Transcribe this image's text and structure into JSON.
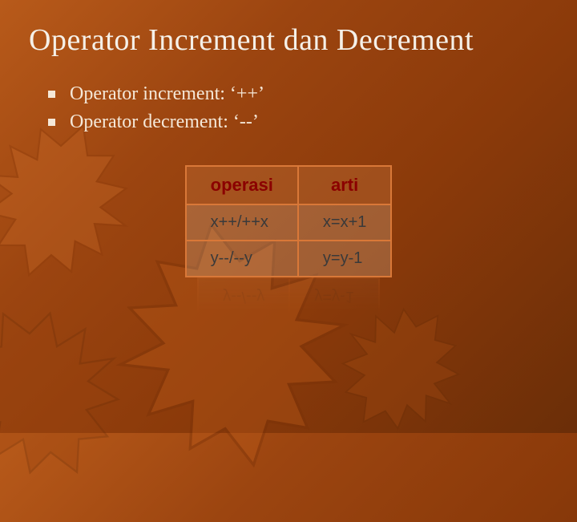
{
  "title": "Operator Increment dan Decrement",
  "bullets": [
    "Operator increment: ‘++’",
    "Operator decrement: ‘--’"
  ],
  "table": {
    "headers": [
      "operasi",
      "arti"
    ],
    "rows": [
      [
        "x++/++x",
        "x=x+1"
      ],
      [
        "y--/--y",
        "y=y-1"
      ]
    ]
  }
}
